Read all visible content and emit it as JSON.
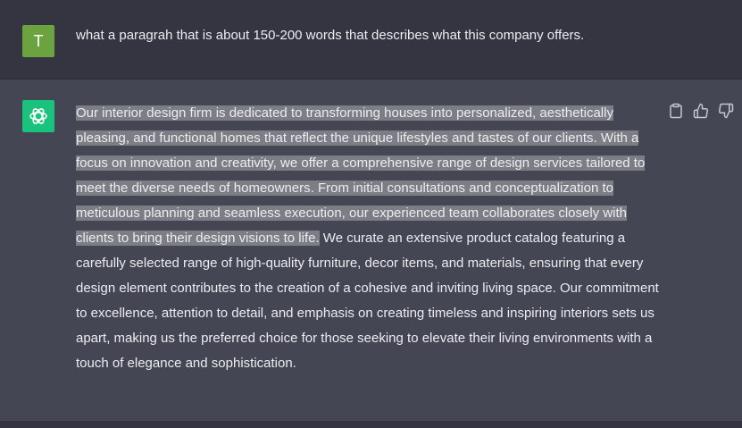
{
  "user_message": {
    "avatar_initial": "T",
    "avatar_color": "#6aa33f",
    "text": "what a paragrah that is about 150-200 words that describes what this company offers."
  },
  "assistant_message": {
    "avatar_color": "#19c37d",
    "avatar_icon": "openai-logo-icon",
    "selected_text": "Our interior design firm is dedicated to transforming houses into personalized, aesthetically pleasing, and functional homes that reflect the unique lifestyles and tastes of our clients. With a focus on innovation and creativity, we offer a comprehensive range of design services tailored to meet the diverse needs of homeowners. From initial consultations and conceptualization to meticulous planning and seamless execution, our experienced team collaborates closely with clients to bring their design visions to life.",
    "rest_text": " We curate an extensive product catalog featuring a carefully selected range of high-quality furniture, decor items, and materials, ensuring that every design element contributes to the creation of a cohesive and inviting living space. Our commitment to excellence, attention to detail, and emphasis on creating timeless and inspiring interiors sets us apart, making us the preferred choice for those seeking to elevate their living environments with a touch of elegance and sophistication.",
    "actions": [
      "clipboard-icon",
      "thumbs-up-icon",
      "thumbs-down-icon"
    ]
  },
  "colors": {
    "page_bg": "#343541",
    "assistant_bg": "#444654",
    "selection": "#7d7e85",
    "text": "#ececf1",
    "icon": "#c5c5d2"
  }
}
